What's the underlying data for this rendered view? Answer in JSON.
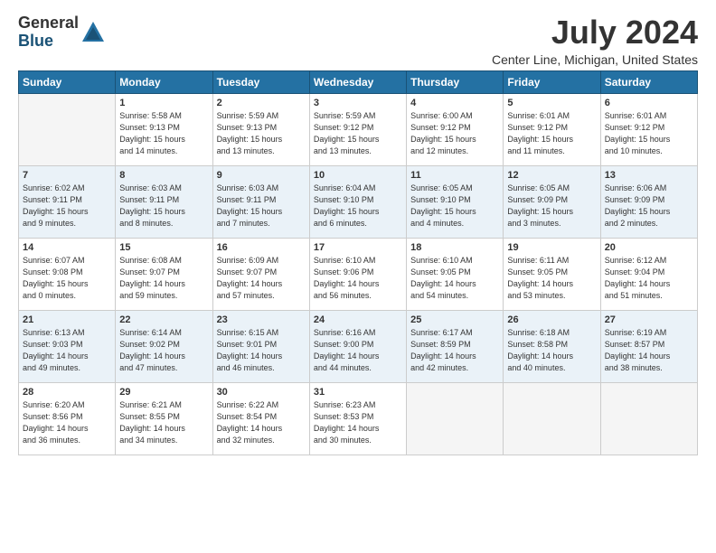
{
  "header": {
    "logo_general": "General",
    "logo_blue": "Blue",
    "title": "July 2024",
    "location": "Center Line, Michigan, United States"
  },
  "weekdays": [
    "Sunday",
    "Monday",
    "Tuesday",
    "Wednesday",
    "Thursday",
    "Friday",
    "Saturday"
  ],
  "weeks": [
    [
      {
        "day": "",
        "info": ""
      },
      {
        "day": "1",
        "info": "Sunrise: 5:58 AM\nSunset: 9:13 PM\nDaylight: 15 hours\nand 14 minutes."
      },
      {
        "day": "2",
        "info": "Sunrise: 5:59 AM\nSunset: 9:13 PM\nDaylight: 15 hours\nand 13 minutes."
      },
      {
        "day": "3",
        "info": "Sunrise: 5:59 AM\nSunset: 9:12 PM\nDaylight: 15 hours\nand 13 minutes."
      },
      {
        "day": "4",
        "info": "Sunrise: 6:00 AM\nSunset: 9:12 PM\nDaylight: 15 hours\nand 12 minutes."
      },
      {
        "day": "5",
        "info": "Sunrise: 6:01 AM\nSunset: 9:12 PM\nDaylight: 15 hours\nand 11 minutes."
      },
      {
        "day": "6",
        "info": "Sunrise: 6:01 AM\nSunset: 9:12 PM\nDaylight: 15 hours\nand 10 minutes."
      }
    ],
    [
      {
        "day": "7",
        "info": "Sunrise: 6:02 AM\nSunset: 9:11 PM\nDaylight: 15 hours\nand 9 minutes."
      },
      {
        "day": "8",
        "info": "Sunrise: 6:03 AM\nSunset: 9:11 PM\nDaylight: 15 hours\nand 8 minutes."
      },
      {
        "day": "9",
        "info": "Sunrise: 6:03 AM\nSunset: 9:11 PM\nDaylight: 15 hours\nand 7 minutes."
      },
      {
        "day": "10",
        "info": "Sunrise: 6:04 AM\nSunset: 9:10 PM\nDaylight: 15 hours\nand 6 minutes."
      },
      {
        "day": "11",
        "info": "Sunrise: 6:05 AM\nSunset: 9:10 PM\nDaylight: 15 hours\nand 4 minutes."
      },
      {
        "day": "12",
        "info": "Sunrise: 6:05 AM\nSunset: 9:09 PM\nDaylight: 15 hours\nand 3 minutes."
      },
      {
        "day": "13",
        "info": "Sunrise: 6:06 AM\nSunset: 9:09 PM\nDaylight: 15 hours\nand 2 minutes."
      }
    ],
    [
      {
        "day": "14",
        "info": "Sunrise: 6:07 AM\nSunset: 9:08 PM\nDaylight: 15 hours\nand 0 minutes."
      },
      {
        "day": "15",
        "info": "Sunrise: 6:08 AM\nSunset: 9:07 PM\nDaylight: 14 hours\nand 59 minutes."
      },
      {
        "day": "16",
        "info": "Sunrise: 6:09 AM\nSunset: 9:07 PM\nDaylight: 14 hours\nand 57 minutes."
      },
      {
        "day": "17",
        "info": "Sunrise: 6:10 AM\nSunset: 9:06 PM\nDaylight: 14 hours\nand 56 minutes."
      },
      {
        "day": "18",
        "info": "Sunrise: 6:10 AM\nSunset: 9:05 PM\nDaylight: 14 hours\nand 54 minutes."
      },
      {
        "day": "19",
        "info": "Sunrise: 6:11 AM\nSunset: 9:05 PM\nDaylight: 14 hours\nand 53 minutes."
      },
      {
        "day": "20",
        "info": "Sunrise: 6:12 AM\nSunset: 9:04 PM\nDaylight: 14 hours\nand 51 minutes."
      }
    ],
    [
      {
        "day": "21",
        "info": "Sunrise: 6:13 AM\nSunset: 9:03 PM\nDaylight: 14 hours\nand 49 minutes."
      },
      {
        "day": "22",
        "info": "Sunrise: 6:14 AM\nSunset: 9:02 PM\nDaylight: 14 hours\nand 47 minutes."
      },
      {
        "day": "23",
        "info": "Sunrise: 6:15 AM\nSunset: 9:01 PM\nDaylight: 14 hours\nand 46 minutes."
      },
      {
        "day": "24",
        "info": "Sunrise: 6:16 AM\nSunset: 9:00 PM\nDaylight: 14 hours\nand 44 minutes."
      },
      {
        "day": "25",
        "info": "Sunrise: 6:17 AM\nSunset: 8:59 PM\nDaylight: 14 hours\nand 42 minutes."
      },
      {
        "day": "26",
        "info": "Sunrise: 6:18 AM\nSunset: 8:58 PM\nDaylight: 14 hours\nand 40 minutes."
      },
      {
        "day": "27",
        "info": "Sunrise: 6:19 AM\nSunset: 8:57 PM\nDaylight: 14 hours\nand 38 minutes."
      }
    ],
    [
      {
        "day": "28",
        "info": "Sunrise: 6:20 AM\nSunset: 8:56 PM\nDaylight: 14 hours\nand 36 minutes."
      },
      {
        "day": "29",
        "info": "Sunrise: 6:21 AM\nSunset: 8:55 PM\nDaylight: 14 hours\nand 34 minutes."
      },
      {
        "day": "30",
        "info": "Sunrise: 6:22 AM\nSunset: 8:54 PM\nDaylight: 14 hours\nand 32 minutes."
      },
      {
        "day": "31",
        "info": "Sunrise: 6:23 AM\nSunset: 8:53 PM\nDaylight: 14 hours\nand 30 minutes."
      },
      {
        "day": "",
        "info": ""
      },
      {
        "day": "",
        "info": ""
      },
      {
        "day": "",
        "info": ""
      }
    ]
  ]
}
